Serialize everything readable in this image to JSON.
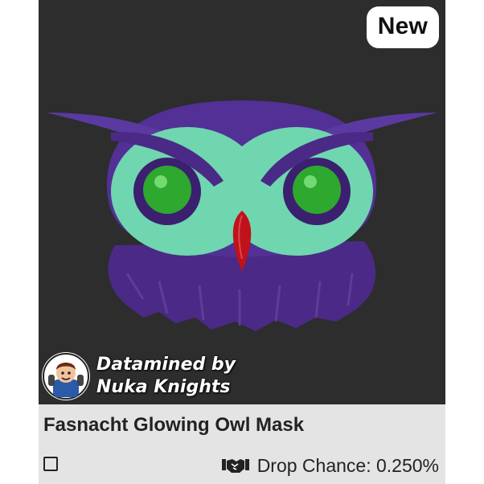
{
  "item": {
    "name": "Fasnacht Glowing Owl Mask",
    "badge": "New",
    "image_icon": "owl-mask-image",
    "credit": {
      "line1": "Datamined by",
      "line2": "Nuka Knights",
      "avatar_icon": "nuka-knights-avatar"
    },
    "drop": {
      "icon": "handshake-icon",
      "label": "Drop Chance: 0.250%"
    },
    "checkbox": {
      "checked": false
    }
  },
  "colors": {
    "image_background": "#2d2d2d",
    "card_background": "#e4e4e4",
    "badge_background": "#ffffff",
    "owl_purple": "#4a2a86",
    "owl_mint": "#6fd6b0",
    "eye_green": "#2ea82e",
    "beak_red": "#c0121a"
  }
}
